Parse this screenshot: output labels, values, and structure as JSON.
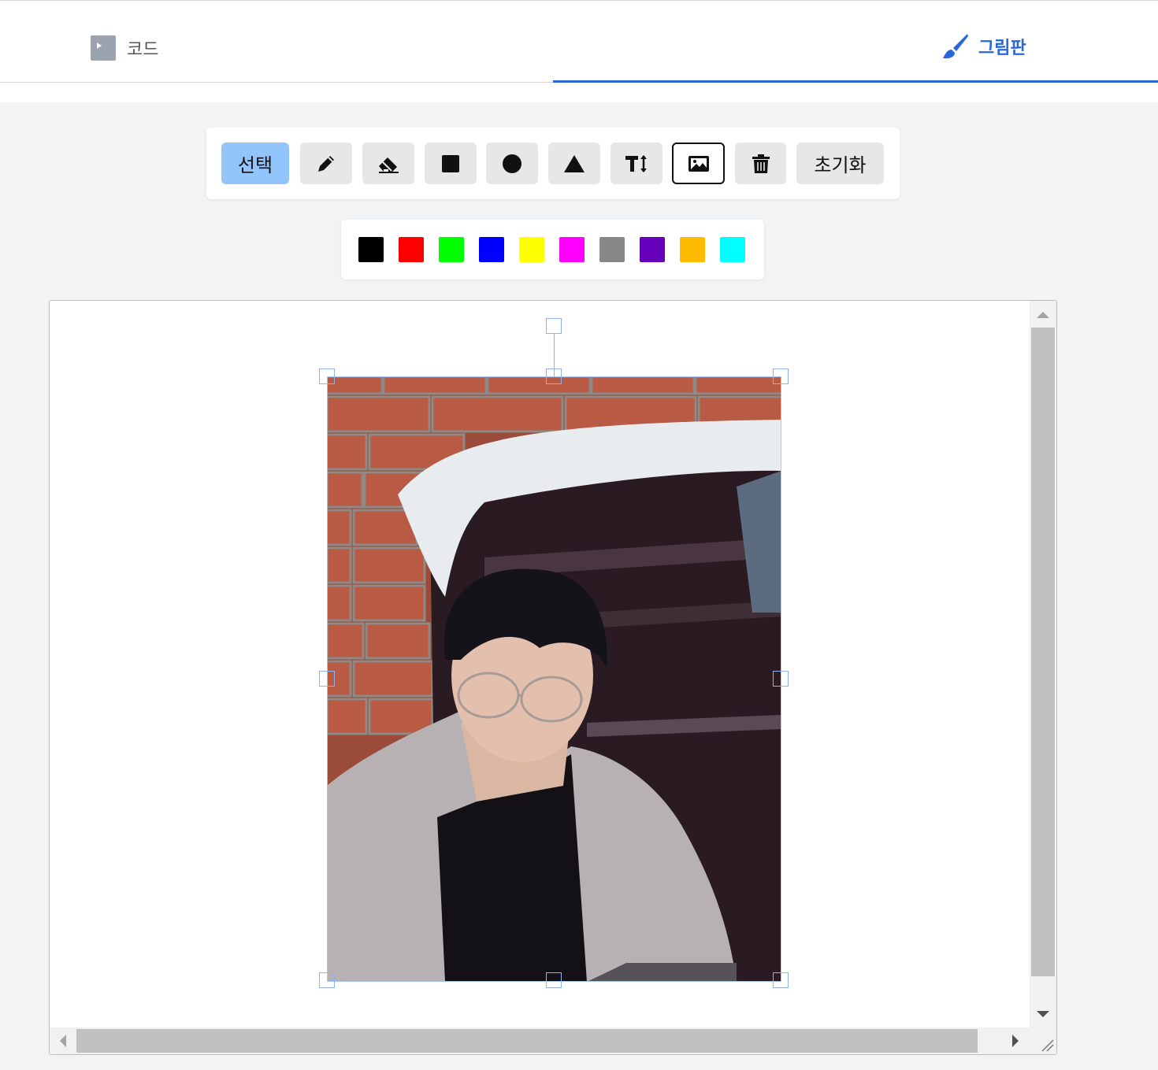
{
  "tabs": {
    "code_label": "코드",
    "draw_label": "그림판",
    "active": "draw"
  },
  "toolbar": {
    "select_label": "선택",
    "reset_label": "초기화",
    "tools": [
      "select",
      "pencil-icon",
      "eraser-icon",
      "square-icon",
      "circle-icon",
      "triangle-icon",
      "text-size-icon",
      "image-icon",
      "trash-icon",
      "reset"
    ]
  },
  "palette": {
    "colors": [
      "#000000",
      "#ff0000",
      "#00ff00",
      "#0000ff",
      "#ffff00",
      "#ff00ff",
      "#888888",
      "#6600bb",
      "#ffbb00",
      "#00ffff"
    ]
  },
  "colors": {
    "accent": "#2a67d8",
    "active_tool": "#93c5fd"
  }
}
